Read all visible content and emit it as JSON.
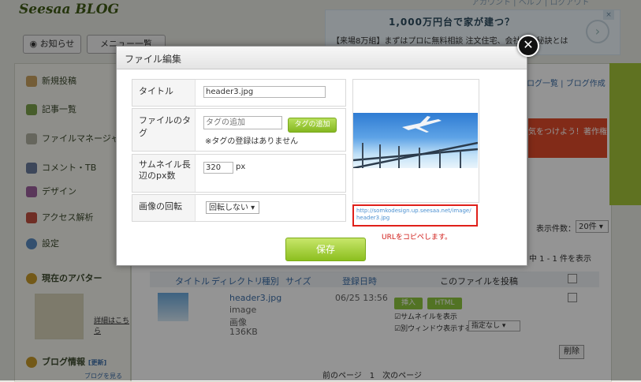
{
  "background": {
    "logo": "Seesaa BLOG",
    "top_links": "アカウント | ヘルプ | ログアウト",
    "tabs": [
      "お知らせ",
      "メニュー一覧"
    ],
    "ad": {
      "title": "1,000万円台で家が建つ？",
      "subtitle": "【来場8万組】まずはプロに無料相談 注文住宅、会社の…秘訣とは",
      "close": "×"
    },
    "sidebar": {
      "items": [
        "新規投稿",
        "記事一覧",
        "ファイルマネージャ",
        "コメント・TB",
        "デザイン",
        "アクセス解析",
        "設定"
      ],
      "avatar_heading": "現在のアバター",
      "avatar_link": "詳細はこちら",
      "blog_info": "ブログ情報",
      "blog_info_tag": "[更新]",
      "blog_info_link": "ブログを見る"
    },
    "right_links": "ログ一覧 | ブログ作成",
    "banner_text": "気をつけよう！著作権",
    "count_label": "表示件数：",
    "count_value": "20件",
    "range_text": "中 1 - 1 件を表示",
    "table": {
      "headers": [
        "タイトル",
        "ディレクトリ",
        "種別",
        "サイズ",
        "登録日時",
        "このファイルを投稿"
      ],
      "row": {
        "name": "header3.jpg",
        "type1": "image",
        "type2": "画像",
        "size": "136KB",
        "date": "06/25 13:56",
        "insert": "挿入",
        "html": "HTML",
        "opt1": "サムネイルを表示",
        "opt2": "別ウィンドウ表示する",
        "opt2_select": "指定なし"
      },
      "delete": "削除"
    },
    "pager": "前のページ　1　次のページ"
  },
  "modal": {
    "title": "ファイル編集",
    "close": "✕",
    "fields": {
      "title_label": "タイトル",
      "title_value": "header3.jpg",
      "tag_label": "ファイルのタグ",
      "tag_placeholder": "タグの追加",
      "tag_button": "タグの追加",
      "tag_note": "※タグの登録はありません",
      "thumb_label": "サムネイル長辺のpx数",
      "thumb_value": "320",
      "thumb_unit": "px",
      "rotate_label": "画像の回転",
      "rotate_value": "回転しない"
    },
    "url": "http://somkodesign.up.seesaa.net/image/header3.jpg",
    "copy_note": "URLをコピペします。",
    "save": "保存"
  }
}
